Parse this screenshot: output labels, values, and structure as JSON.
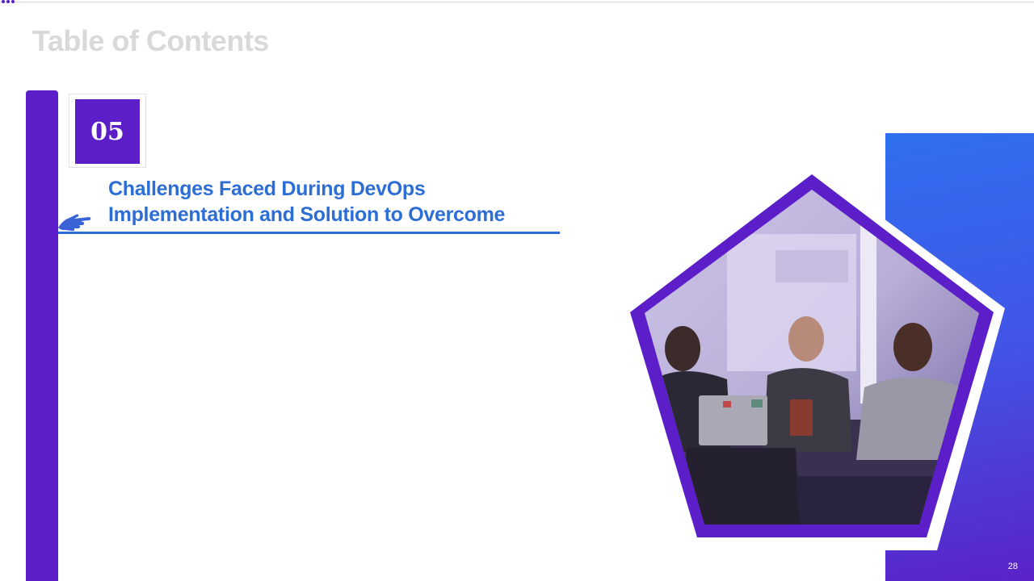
{
  "slide": {
    "title": "Table of Contents",
    "section_number": "05",
    "section_heading_line1": "Challenges Faced During DevOps",
    "section_heading_line2": "Implementation and Solution to Overcome",
    "page_number": "28"
  },
  "colors": {
    "primary_purple": "#5b1ec8",
    "heading_blue": "#2c6ed6",
    "title_gray": "#d9d9d9",
    "panel_gradient_start": "#2f6ff0",
    "panel_gradient_end": "#5a22c8"
  },
  "icons": {
    "pointer": "pointing-hand-icon",
    "corner": "three-dots-icon"
  },
  "image": {
    "description": "pentagon-framed photo of three people smiling at a laptop in a meeting room"
  }
}
